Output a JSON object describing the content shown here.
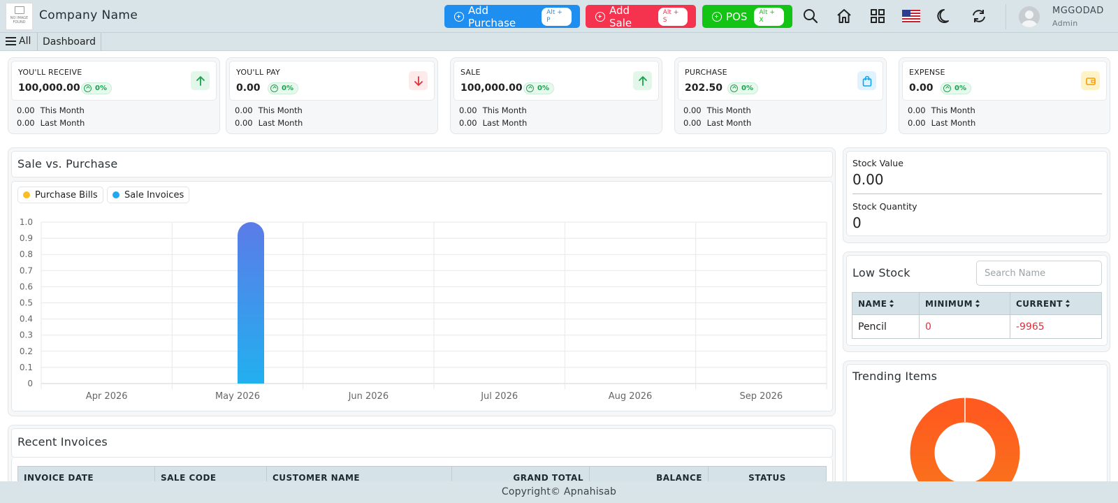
{
  "header": {
    "logo_text": "NO IMAGE FOUND",
    "company_name": "Company Name",
    "buttons": {
      "add_purchase": {
        "label": "Add Purchase",
        "shortcut": "Alt + P",
        "color": "#1e8ff0"
      },
      "add_sale": {
        "label": "Add Sale",
        "shortcut": "Alt + S",
        "color": "#f5334f"
      },
      "pos": {
        "label": "POS",
        "shortcut": "Alt + X",
        "color": "#14c414"
      }
    },
    "icons": [
      "search-icon",
      "home-icon",
      "grid-icon",
      "us-flag-icon",
      "moon-icon",
      "refresh-icon"
    ],
    "user": {
      "name": "MGGODAD",
      "role": "Admin"
    }
  },
  "nav": {
    "all_label": "All",
    "tab_label": "Dashboard"
  },
  "kpis": [
    {
      "title": "YOU'LL RECEIVE",
      "value": "100,000.00",
      "change": "0%",
      "this_month": "0.00",
      "this_month_label": "This Month",
      "last_month": "0.00",
      "last_month_label": "Last Month",
      "icon": "arrow-up-icon"
    },
    {
      "title": "YOU'LL PAY",
      "value": "0.00",
      "change": "0%",
      "this_month": "0.00",
      "this_month_label": "This Month",
      "last_month": "0.00",
      "last_month_label": "Last Month",
      "icon": "arrow-down-icon"
    },
    {
      "title": "SALE",
      "value": "100,000.00",
      "change": "0%",
      "this_month": "0.00",
      "this_month_label": "This Month",
      "last_month": "0.00",
      "last_month_label": "Last Month",
      "icon": "arrow-up-icon"
    },
    {
      "title": "PURCHASE",
      "value": "202.50",
      "change": "0%",
      "this_month": "0.00",
      "this_month_label": "This Month",
      "last_month": "0.00",
      "last_month_label": "Last Month",
      "icon": "shopping-bag-icon"
    },
    {
      "title": "EXPENSE",
      "value": "0.00",
      "change": "0%",
      "this_month": "0.00",
      "this_month_label": "This Month",
      "last_month": "0.00",
      "last_month_label": "Last Month",
      "icon": "wallet-icon"
    }
  ],
  "sale_vs_purchase": {
    "title": "Sale vs. Purchase",
    "legend": [
      {
        "label": "Purchase Bills",
        "color": "#fbbf24"
      },
      {
        "label": "Sale Invoices",
        "color": "#22a7f0"
      }
    ]
  },
  "chart_data": {
    "type": "bar",
    "categories": [
      "Apr 2026",
      "May 2026",
      "Jun 2026",
      "Jul 2026",
      "Aug 2026",
      "Sep 2026"
    ],
    "series": [
      {
        "name": "Purchase Bills",
        "values": [
          0,
          0,
          0,
          0,
          0,
          0
        ]
      },
      {
        "name": "Sale Invoices",
        "values": [
          0,
          1,
          0,
          0,
          0,
          0
        ]
      }
    ],
    "yticks": [
      "0",
      "0.1",
      "0.2",
      "0.3",
      "0.4",
      "0.5",
      "0.6",
      "0.7",
      "0.8",
      "0.9",
      "1.0"
    ],
    "ylim": [
      0,
      1
    ],
    "grid": true,
    "legend_position": "top-left"
  },
  "stock": {
    "value_label": "Stock Value",
    "value": "0.00",
    "quantity_label": "Stock Quantity",
    "quantity": "0"
  },
  "low_stock": {
    "title": "Low Stock",
    "search_placeholder": "Search Name",
    "columns": [
      "NAME",
      "MINIMUM",
      "CURRENT"
    ],
    "rows": [
      {
        "name": "Pencil",
        "minimum": "0",
        "current": "-9965"
      }
    ]
  },
  "trending": {
    "title": "Trending Items",
    "colors": [
      "#f9731c",
      "#ff5a1f"
    ]
  },
  "recent_invoices": {
    "title": "Recent Invoices",
    "columns": [
      "INVOICE DATE",
      "SALE CODE",
      "CUSTOMER NAME",
      "GRAND TOTAL",
      "BALANCE",
      "STATUS"
    ]
  },
  "footer": {
    "text": "Copyright© Apnahisab"
  }
}
